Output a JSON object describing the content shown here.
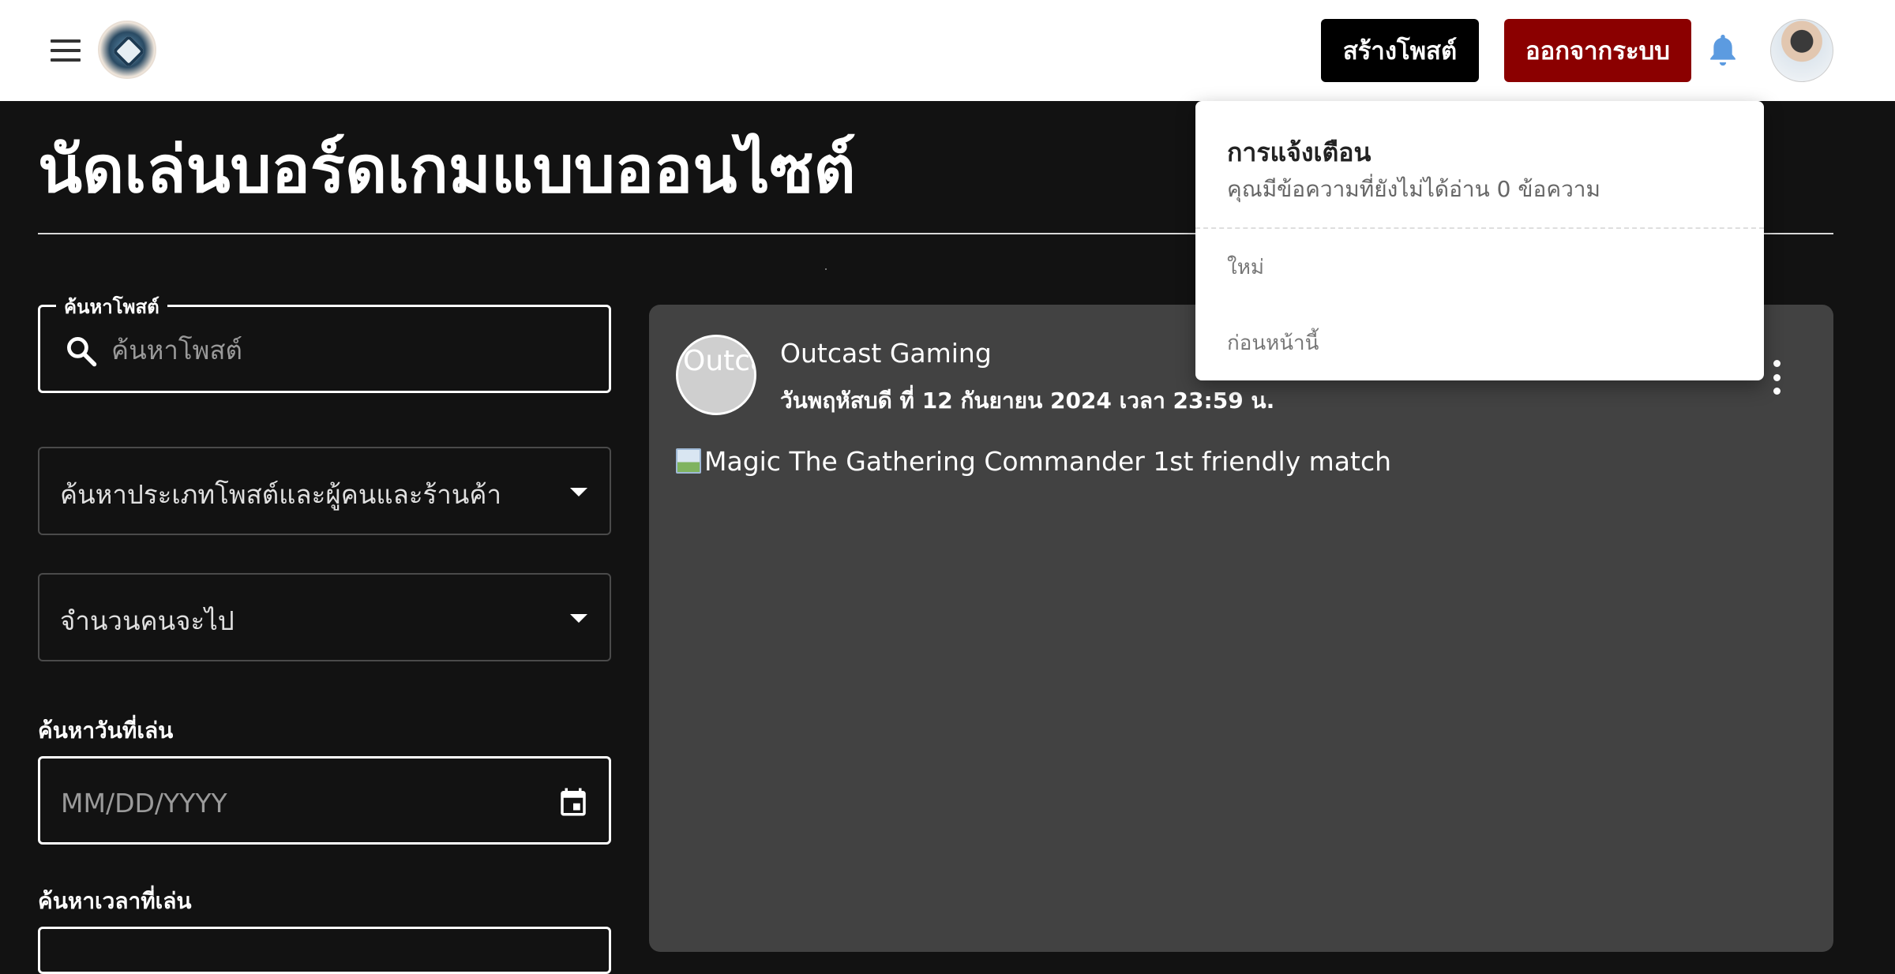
{
  "header": {
    "create_post_label": "สร้างโพสต์",
    "logout_label": "ออกจากระบบ"
  },
  "page": {
    "title": "นัดเล่นบอร์ดเกมแบบออนไซต์"
  },
  "filters": {
    "search_legend": "ค้นหาโพสต์",
    "search_placeholder": "ค้นหาโพสต์",
    "type_select_label": "ค้นหาประเภทโพสต์และผู้คนและร้านค้า",
    "count_select_label": "จำนวนคนจะไป",
    "date_label": "ค้นหาวันที่เล่น",
    "date_placeholder": "MM/DD/YYYY",
    "time_label": "ค้นหาเวลาที่เล่น"
  },
  "post": {
    "avatar_alt": "Outca",
    "author": "Outcast Gaming",
    "date": "วันพฤหัสบดี ที่ 12 กันยายน 2024 เวลา 23:59 น.",
    "image_alt": "Magic The Gathering Commander 1st friendly match"
  },
  "notifications": {
    "title": "การแจ้งเตือน",
    "subtitle": "คุณมีข้อความที่ยังไม่ได้อ่าน 0 ข้อความ",
    "section_new": "ใหม่",
    "section_previous": "ก่อนหน้านี้"
  },
  "colors": {
    "page_bg": "#121212",
    "card_bg": "#424242",
    "logout_bg": "#8b0000",
    "create_bg": "#000000",
    "bell": "#4a90d9"
  },
  "icons": {
    "menu": "hamburger-menu-icon",
    "bell": "bell-icon",
    "search": "search-icon",
    "calendar": "calendar-icon",
    "more": "more-vertical-icon"
  }
}
